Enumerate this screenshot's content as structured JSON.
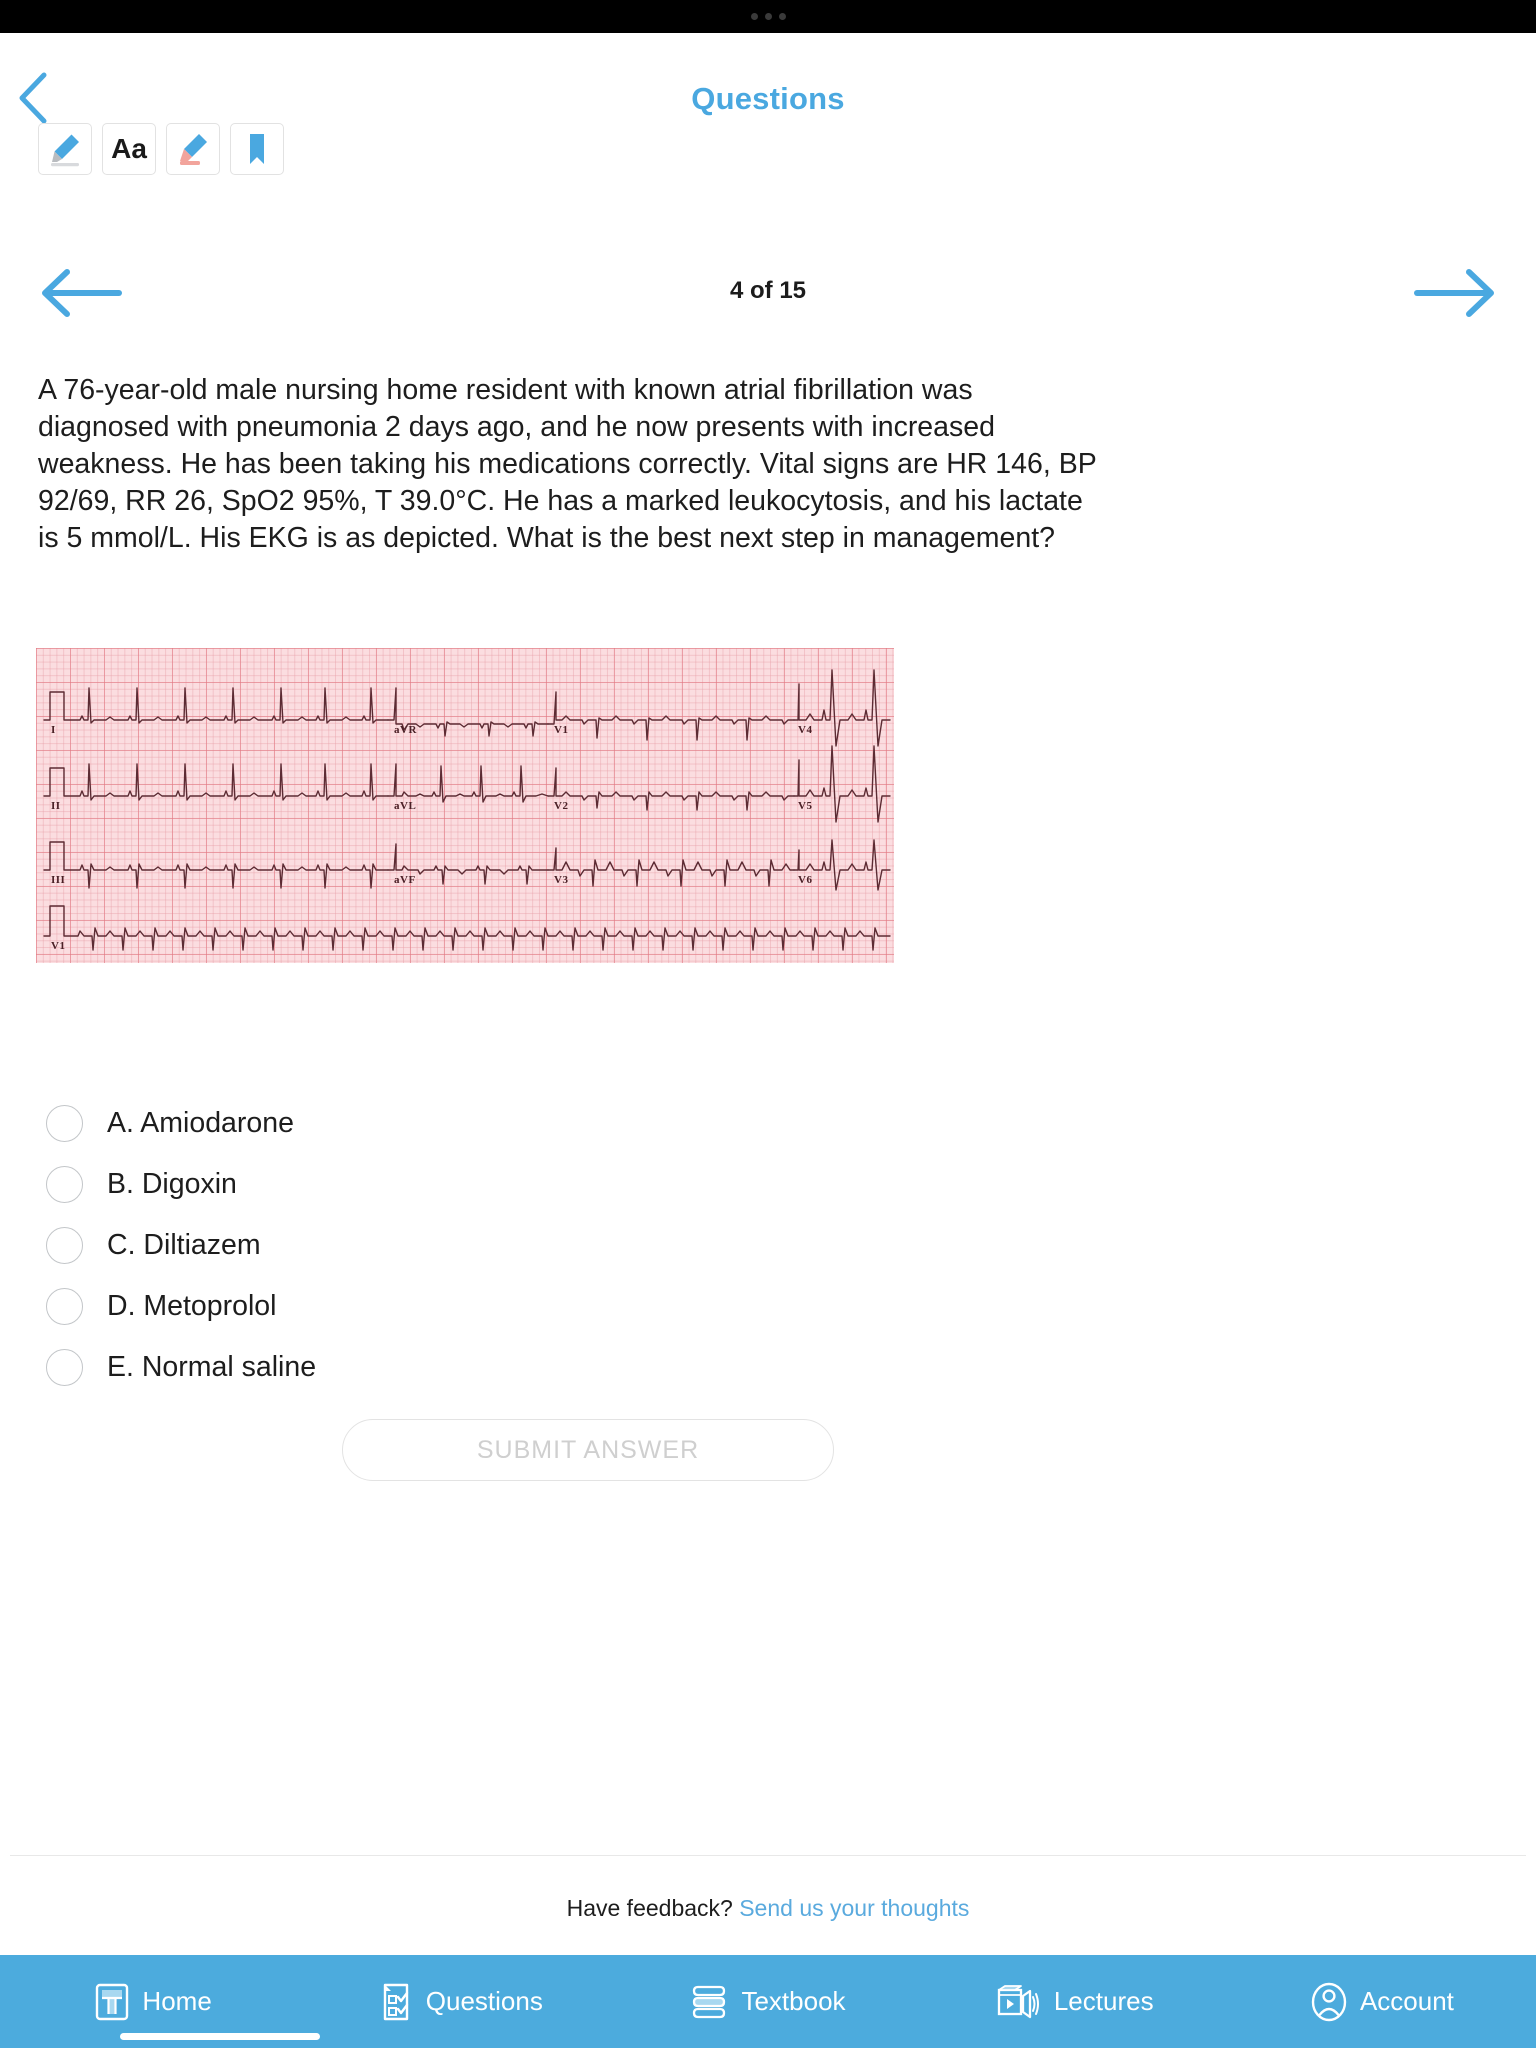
{
  "statusbar": {
    "dots": 3
  },
  "header": {
    "title": "Questions",
    "back_icon": "chevron-left-icon"
  },
  "toolbar": {
    "items": [
      {
        "name": "highlighter-tool",
        "icon": "highlighter-icon",
        "label": ""
      },
      {
        "name": "text-size-tool",
        "icon": "text-size-icon",
        "label": "Aa"
      },
      {
        "name": "eraser-tool",
        "icon": "eraser-icon",
        "label": ""
      },
      {
        "name": "bookmark-tool",
        "icon": "bookmark-icon",
        "label": ""
      }
    ]
  },
  "pager": {
    "prev_icon": "arrow-left-icon",
    "next_icon": "arrow-right-icon",
    "label": "4 of 15",
    "current": 4,
    "total": 15
  },
  "question": {
    "stem": "A 76-year-old male nursing home resident with known atrial fibrillation was diagnosed with pneumonia 2 days ago, and he now presents with increased weakness.  He has been taking his medications correctly. Vital signs are HR 146, BP 92/69, RR 26, SpO2 95%, T 39.0°C. He has a marked leukocytosis, and his lactate is 5 mmol/L. His EKG is as depicted. What is the best next step in management?",
    "image": {
      "name": "ekg-12-lead-image",
      "alt": "12-lead EKG on pink grid paper showing irregularly irregular narrow-complex tachycardia",
      "lead_labels": [
        "I",
        "aVR",
        "V1",
        "V4",
        "II",
        "aVL",
        "V2",
        "V5",
        "III",
        "aVF",
        "V3",
        "V6",
        "V1"
      ],
      "grid_color": "#e27882",
      "paper_color": "#fbdde0",
      "trace_color": "#5c2b33"
    },
    "options": [
      {
        "id": "A",
        "label": "A. Amiodarone",
        "selected": false
      },
      {
        "id": "B",
        "label": "B. Digoxin",
        "selected": false
      },
      {
        "id": "C",
        "label": "C. Diltiazem",
        "selected": false
      },
      {
        "id": "D",
        "label": "D. Metoprolol",
        "selected": false
      },
      {
        "id": "E",
        "label": "E. Normal saline",
        "selected": false
      }
    ],
    "submit_label": "SUBMIT ANSWER"
  },
  "feedback": {
    "prompt": "Have feedback?",
    "link": "Send us your thoughts"
  },
  "bottomnav": {
    "items": [
      {
        "name": "nav-home",
        "icon": "home-icon",
        "label": "Home"
      },
      {
        "name": "nav-questions",
        "icon": "questions-icon",
        "label": "Questions"
      },
      {
        "name": "nav-textbook",
        "icon": "textbook-icon",
        "label": "Textbook"
      },
      {
        "name": "nav-lectures",
        "icon": "lectures-icon",
        "label": "Lectures"
      },
      {
        "name": "nav-account",
        "icon": "account-icon",
        "label": "Account"
      }
    ],
    "accent": "#4cabdd"
  }
}
